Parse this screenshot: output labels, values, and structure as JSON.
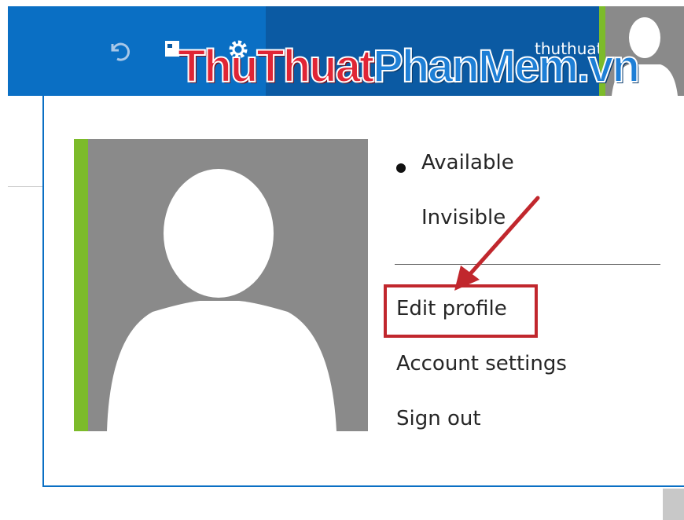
{
  "header": {
    "account_email": "thuthuatphanmem.vn",
    "icons": [
      "undo-icon",
      "compose-icon",
      "gear-icon",
      "avatar"
    ]
  },
  "watermark": {
    "part1": "ThuThuat",
    "part2": "PhanMem.vn"
  },
  "profile_menu": {
    "status_items": [
      {
        "label": "Available",
        "selected": true
      },
      {
        "label": "Invisible",
        "selected": false
      }
    ],
    "actions": [
      {
        "label": "Edit profile",
        "highlighted": true
      },
      {
        "label": "Account settings"
      },
      {
        "label": "Sign out"
      }
    ]
  },
  "colors": {
    "brand_blue": "#0a6fc4",
    "presence_green": "#7cbb2a",
    "highlight_red": "#c1272d",
    "avatar_gray": "#8a8a8a"
  }
}
